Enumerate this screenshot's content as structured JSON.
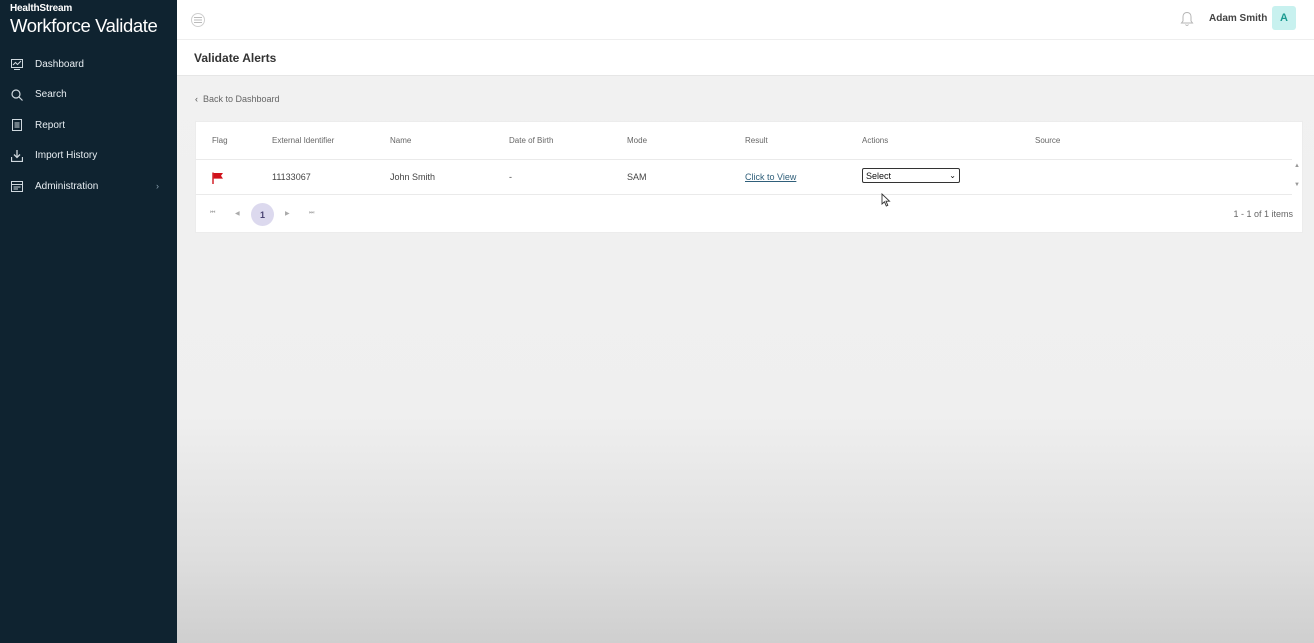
{
  "brand": {
    "top": "HealthStream",
    "main": "Workforce Validate"
  },
  "sidebar": {
    "items": [
      {
        "label": "Dashboard",
        "icon": "dashboard-icon"
      },
      {
        "label": "Search",
        "icon": "search-icon"
      },
      {
        "label": "Report",
        "icon": "report-icon"
      },
      {
        "label": "Import History",
        "icon": "import-icon"
      },
      {
        "label": "Administration",
        "icon": "admin-icon"
      }
    ]
  },
  "topbar": {
    "user_name": "Adam Smith",
    "avatar_initial": "A"
  },
  "page": {
    "title": "Validate Alerts",
    "back_label": "Back to Dashboard"
  },
  "table": {
    "columns": [
      "Flag",
      "External Identifier",
      "Name",
      "Date of Birth",
      "Mode",
      "Result",
      "Actions",
      "Source"
    ],
    "rows": [
      {
        "external_id": "11133067",
        "name": "John Smith",
        "dob": "-",
        "mode": "SAM",
        "result": "Click to View",
        "action": "Select",
        "source": ""
      }
    ]
  },
  "pager": {
    "current_page": "1",
    "info": "1 - 1 of 1 items"
  },
  "colors": {
    "sidebar_bg": "#0f2330",
    "flag": "#d0121b",
    "avatar_bg": "#c8f1ef",
    "page_active": "#dcd9ee"
  }
}
